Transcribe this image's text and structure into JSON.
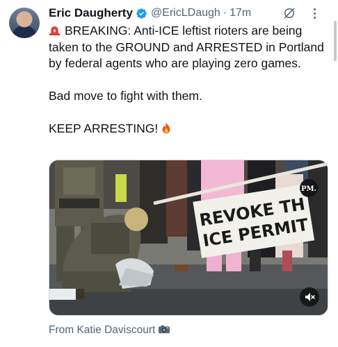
{
  "tweet": {
    "author_name": "Eric Daugherty",
    "handle": "@EricLDaugh",
    "separator": "·",
    "time": "17m",
    "line_breaking": "BREAKING: Anti-ICE leftist rioters are being taken to the GROUND and ARRESTED in Portland by federal agents who are playing zero games.",
    "line_bad_move": "Bad move to fight with them.",
    "line_keep": "KEEP ARRESTING!",
    "icons": [
      "verified-badge-icon",
      "grok-icon",
      "more-icon",
      "siren-emoji",
      "fire-emoji",
      "mute-icon",
      "camera-emoji"
    ]
  },
  "media": {
    "banner_line1": "REVOKE TH",
    "banner_line2": "ICE PERMIT",
    "watermark": "PM."
  },
  "source": {
    "text": "From Katie Daviscourt"
  },
  "colors": {
    "text": "#0f1419",
    "muted": "#536471",
    "verified": "#1d9bf0",
    "border": "#cfd9de"
  }
}
